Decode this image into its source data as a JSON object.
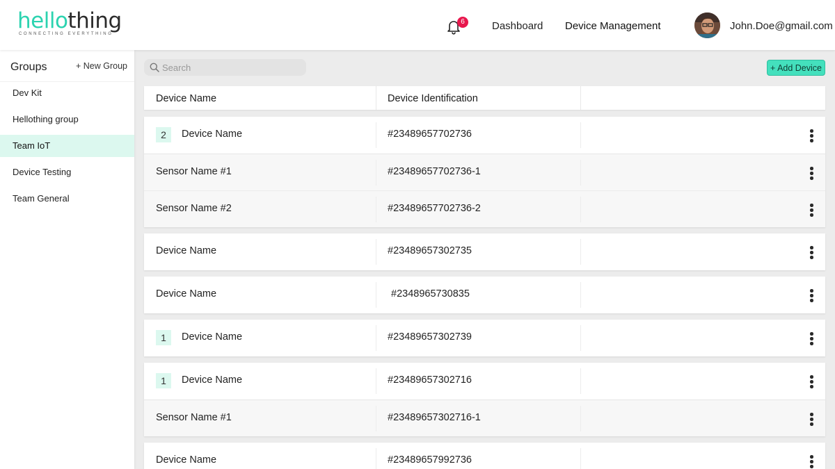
{
  "brand": {
    "logo_hello": "hello",
    "logo_thing": "thing",
    "tagline": "CONNECTING EVERYTHING",
    "accent_color": "#2cd3b0"
  },
  "header": {
    "notification_count": "6",
    "nav": {
      "dashboard": "Dashboard",
      "device_management": "Device Management"
    },
    "user_email": "John.Doe@gmail.com"
  },
  "sidebar": {
    "title": "Groups",
    "new_group_label": "+ New Group",
    "items": [
      {
        "label": "Dev Kit",
        "active": false
      },
      {
        "label": "Hellothing group",
        "active": false
      },
      {
        "label": "Team IoT",
        "active": true
      },
      {
        "label": "Device Testing",
        "active": false
      },
      {
        "label": "Team General",
        "active": false
      }
    ]
  },
  "toolbar": {
    "search_placeholder": "Search",
    "add_device_label": "+ Add Device"
  },
  "table": {
    "columns": [
      "Device Name",
      "Device Identification"
    ],
    "groups": [
      {
        "count": "2",
        "name": "Device Name",
        "id": "#23489657702736",
        "children": [
          {
            "name": "Sensor Name #1",
            "id": "#23489657702736-1"
          },
          {
            "name": "Sensor Name #2",
            "id": "#23489657702736-2"
          }
        ]
      },
      {
        "count": "",
        "name": "Device Name",
        "id": "#23489657302735",
        "children": []
      },
      {
        "count": "",
        "name": "Device Name",
        "id": "#2348965730835",
        "children": []
      },
      {
        "count": "1",
        "name": "Device Name",
        "id": "#23489657302739",
        "children": []
      },
      {
        "count": "1",
        "name": "Device Name",
        "id": "#23489657302716",
        "children": [
          {
            "name": "Sensor Name #1",
            "id": "#23489657302716-1"
          }
        ]
      },
      {
        "count": "",
        "name": "Device Name",
        "id": "#23489657992736",
        "children": []
      }
    ]
  }
}
